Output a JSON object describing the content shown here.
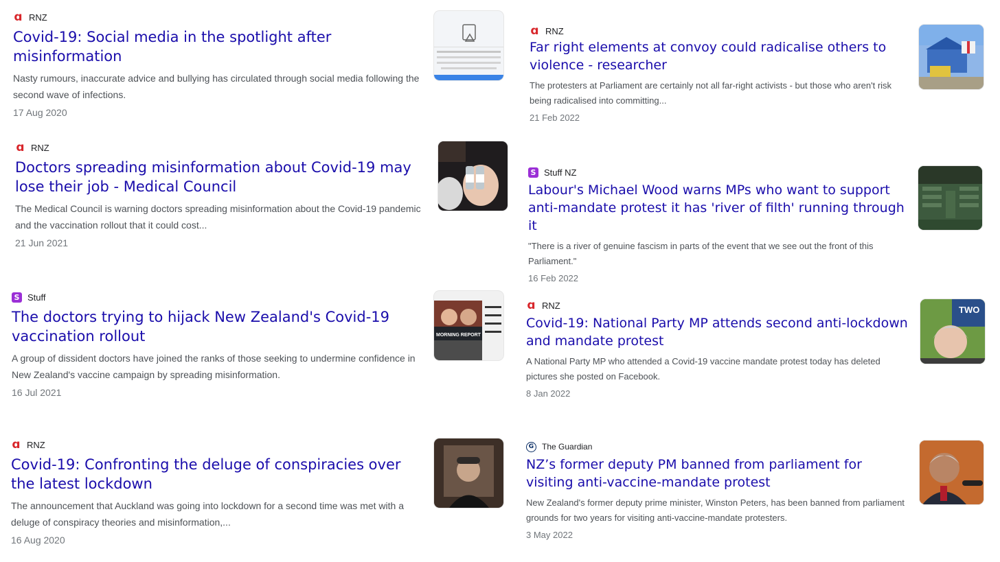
{
  "articles": [
    {
      "source": "RNZ",
      "logo": "rnz-logo",
      "title": "Covid-19: Social media in the spotlight after misinformation",
      "snippet": "Nasty rumours, inaccurate advice and bullying has circulated through social media following the second wave of infections.",
      "date": "17 Aug 2020",
      "thumb": {
        "alt": "facebook-warning-thumbnail",
        "caption": "You Commented on Contained False Info"
      }
    },
    {
      "source": "RNZ",
      "logo": "rnz-logo",
      "title": "Doctors spreading misinformation about Covid-19 may lose their job - Medical Council",
      "snippet": "The Medical Council is warning doctors spreading misinformation about the Covid-19 pandemic and the vaccination rollout that it could cost...",
      "date": "21 Jun 2021",
      "thumb": {
        "alt": "vaccine-vials-thumbnail"
      }
    },
    {
      "source": "Stuff",
      "logo": "stuff-logo",
      "title": "The doctors trying to hijack New Zealand's Covid-19 vaccination rollout",
      "snippet": "A group of dissident doctors have joined the ranks of those seeking to undermine confidence in New Zealand's vaccine campaign by spreading misinformation.",
      "date": "16 Jul 2021",
      "thumb": {
        "alt": "morning-report-thumbnail",
        "caption": "MORNING REPORT"
      }
    },
    {
      "source": "RNZ",
      "logo": "rnz-logo",
      "title": "Covid-19: Confronting the deluge of conspiracies over the latest lockdown",
      "snippet": "The announcement that Auckland was going into lockdown for a second time was met with a deluge of conspiracy theories and misinformation,...",
      "date": "16 Aug 2020",
      "thumb": {
        "alt": "video-call-man-thumbnail"
      }
    },
    {
      "source": "RNZ",
      "logo": "rnz-logo",
      "title": "Far right elements at convoy could radicalise others to violence - researcher",
      "snippet": "The protesters at Parliament are certainly not all far-right activists - but those who aren't risk being radicalised into committing...",
      "date": "21 Feb 2022",
      "thumb": {
        "alt": "protest-camp-thumbnail"
      }
    },
    {
      "source": "Stuff NZ",
      "logo": "stuff-logo",
      "title": "Labour's Michael Wood warns MPs who want to support anti-mandate protest it has 'river of filth' running through it",
      "snippet": "\"There is a river of genuine fascism in parts of the event that we see out the front of this Parliament.\"",
      "date": "16 Feb 2022",
      "thumb": {
        "alt": "parliament-chamber-thumbnail"
      }
    },
    {
      "source": "RNZ",
      "logo": "rnz-logo",
      "title": "Covid-19: National Party MP attends second anti-lockdown and mandate protest",
      "snippet": "A National Party MP who attended a Covid-19 vaccine mandate protest today has deleted pictures she posted on Facebook.",
      "date": "8 Jan 2022",
      "thumb": {
        "alt": "mp-portrait-thumbnail",
        "caption": "TWO"
      }
    },
    {
      "source": "The Guardian",
      "logo": "guardian-logo",
      "title": "NZ’s former deputy PM banned from parliament for visiting anti-vaccine-mandate protest",
      "snippet": "New Zealand's former deputy prime minister, Winston Peters, has been banned from parliament grounds for two years for visiting anti-vaccine-mandate protesters.",
      "date": "3 May 2022",
      "thumb": {
        "alt": "deputy-pm-portrait-thumbnail"
      }
    }
  ],
  "colors": {
    "title": "#1a0dab",
    "snippet": "#4d5156",
    "date": "#70757a",
    "rnz": "#d8262b",
    "stuff": "#9b2fd6"
  }
}
